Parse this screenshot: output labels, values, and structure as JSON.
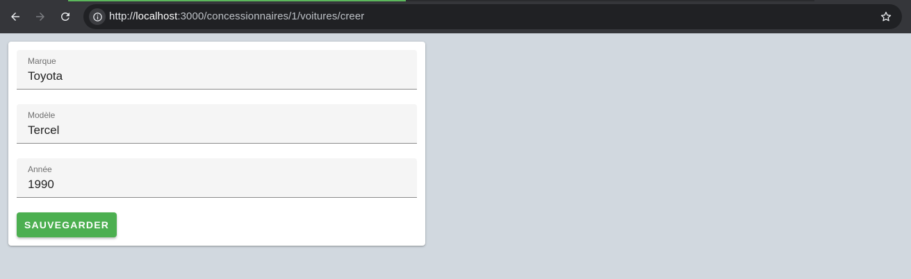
{
  "browser": {
    "url_prefix": "http://",
    "url_host": "localhost",
    "url_path": ":3000/concessionnaires/1/voitures/creer",
    "accent_color": "#5cb85c"
  },
  "form": {
    "fields": [
      {
        "label": "Marque",
        "value": "Toyota"
      },
      {
        "label": "Modèle",
        "value": "Tercel"
      },
      {
        "label": "Année",
        "value": "1990"
      }
    ],
    "save_label": "SAUVEGARDER",
    "button_color": "#4caf50"
  }
}
